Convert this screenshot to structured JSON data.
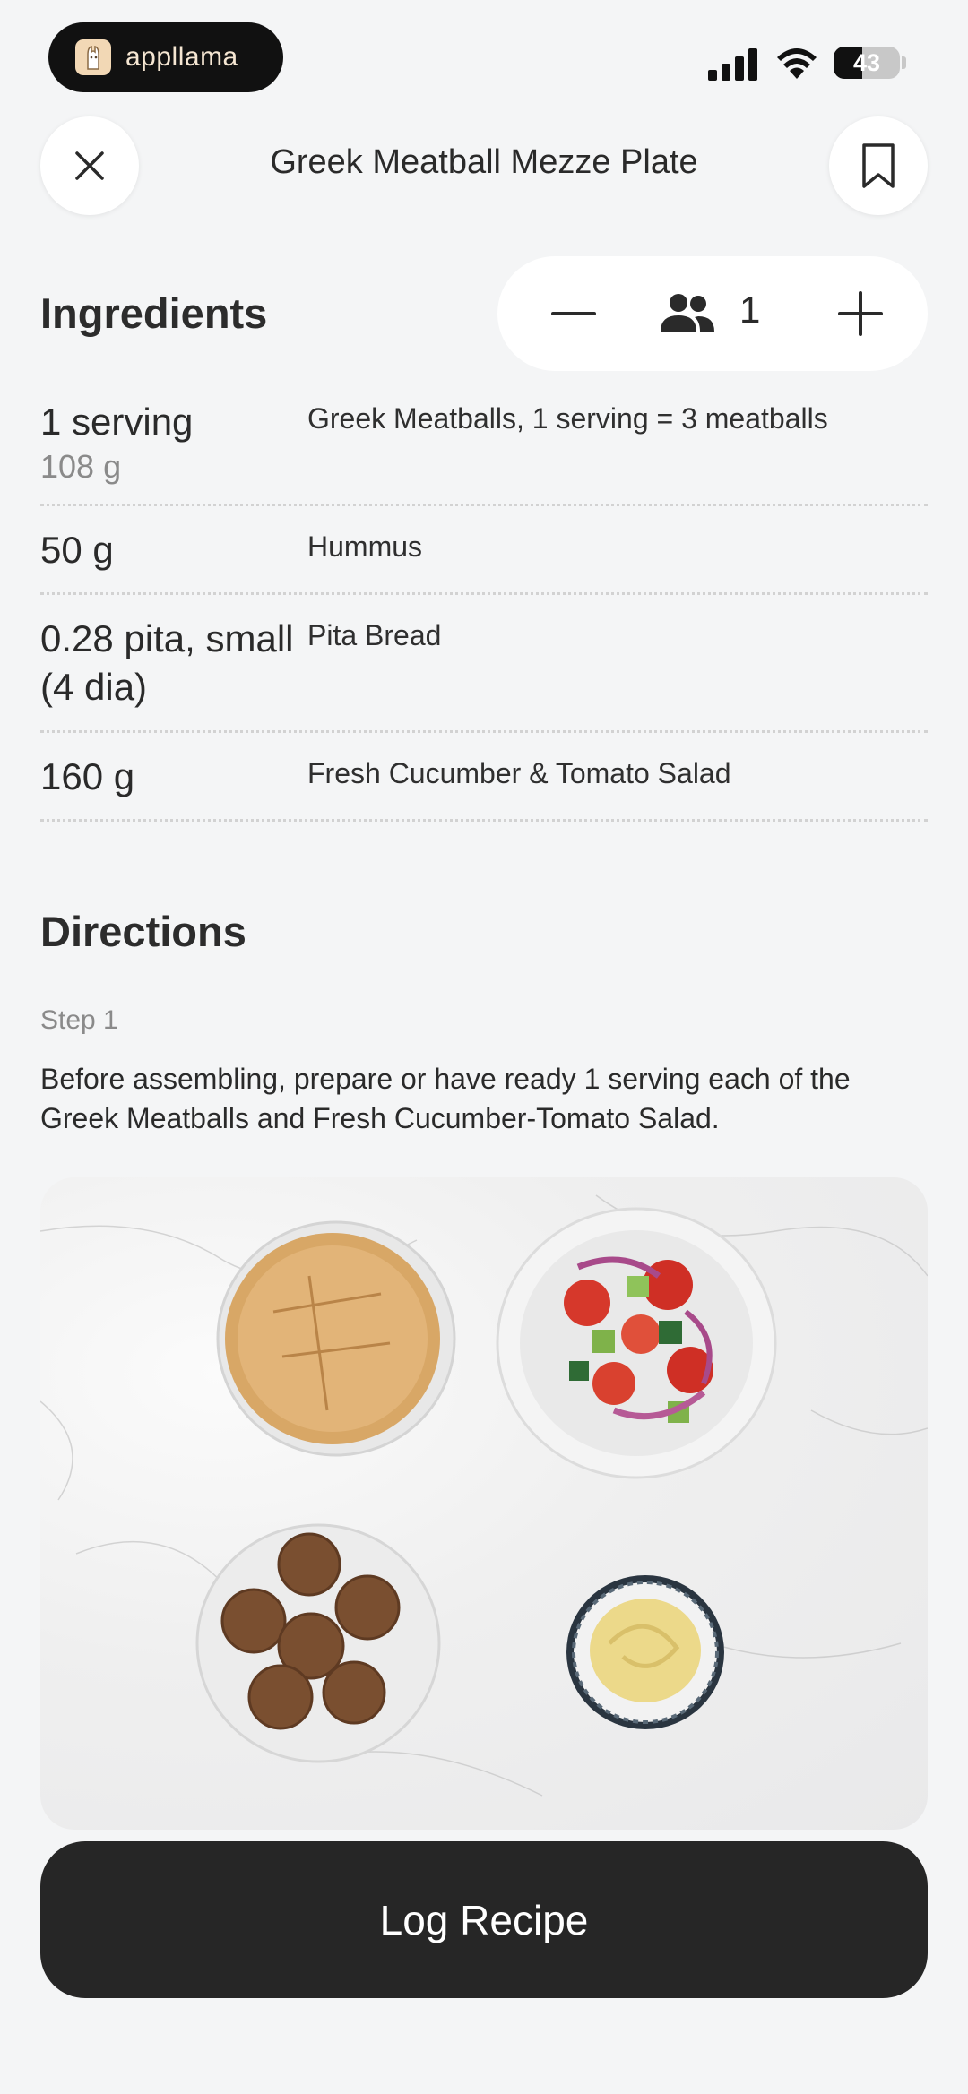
{
  "status_bar": {
    "app_name": "appllama",
    "battery_level": "43",
    "battery_fraction": 0.43
  },
  "header": {
    "title": "Greek Meatball Mezze Plate"
  },
  "ingredients": {
    "heading": "Ingredients",
    "servings": "1",
    "items": [
      {
        "quantity": "1 serving",
        "sub_quantity": "108 g",
        "name": "Greek Meatballs, 1 serving = 3 meatballs"
      },
      {
        "quantity": "50 g",
        "name": "Hummus"
      },
      {
        "quantity": "0.28 pita, small  (4 dia)",
        "name": "Pita Bread"
      },
      {
        "quantity": "160 g",
        "name": "Fresh Cucumber & Tomato Salad"
      }
    ]
  },
  "directions": {
    "heading": "Directions",
    "step_label": "Step 1",
    "step_text": "Before assembling, prepare or have ready 1 serving each of the Greek Meatballs and Fresh Cucumber-Tomato Salad."
  },
  "actions": {
    "log_label": "Log Recipe"
  },
  "colors": {
    "primary_button": "#262626",
    "background": "#f4f5f6"
  }
}
